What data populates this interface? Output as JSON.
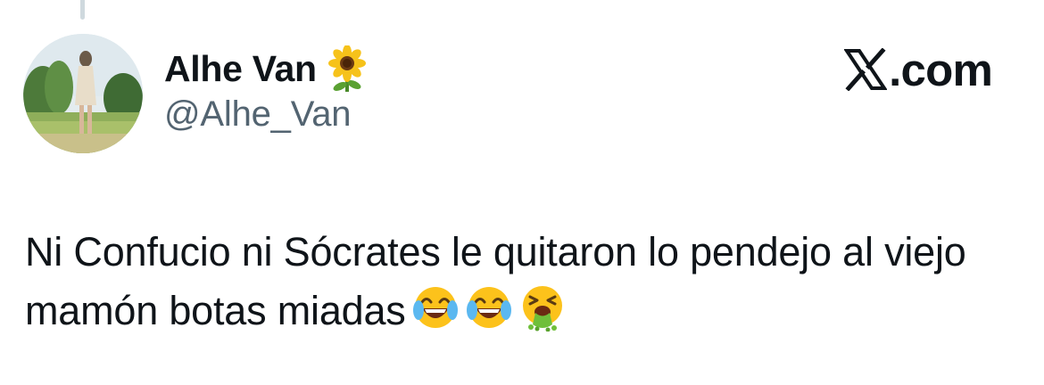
{
  "author": {
    "display_name": "Alhe Van",
    "name_emoji": "sunflower-icon",
    "handle": "@Alhe_Van"
  },
  "brand": {
    "logo": "x-logo-icon",
    "suffix": ".com"
  },
  "tweet": {
    "text": "Ni Confucio ni Sócrates le quitaron lo pendejo al viejo mamón botas miadas",
    "emojis": [
      "face-with-tears-of-joy-icon",
      "face-with-tears-of-joy-icon",
      "face-vomiting-icon"
    ]
  },
  "colors": {
    "text_primary": "#0f1419",
    "text_secondary": "#536471",
    "thread_line": "#cfd9de"
  }
}
